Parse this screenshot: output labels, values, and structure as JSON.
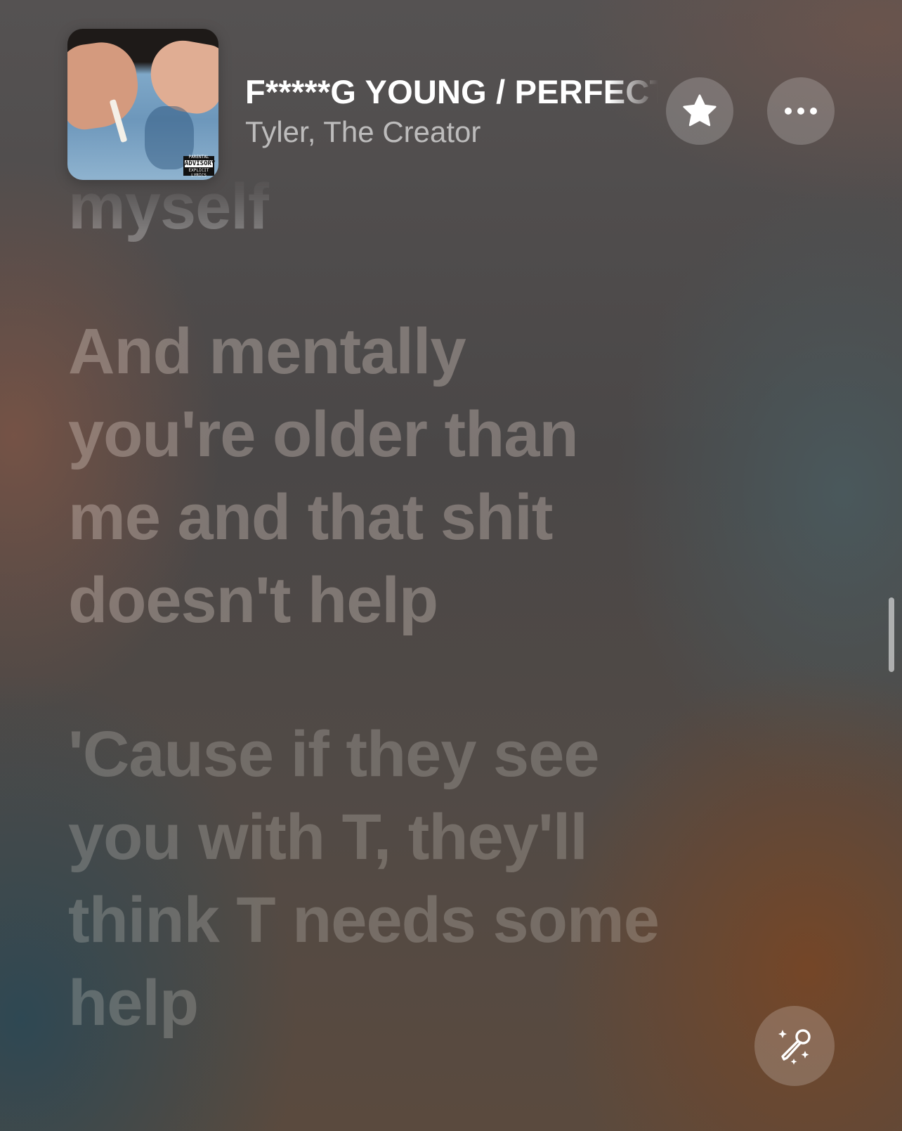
{
  "now_playing": {
    "title": "F*****G YOUNG / PERFECT",
    "artist": "Tyler, The Creator",
    "album_art_icon": "album-cover",
    "advisory_label_top": "PARENTAL",
    "advisory_label_main": "ADVISORY",
    "advisory_label_bottom": "EXPLICIT LYRICS"
  },
  "actions": {
    "favorite_icon": "star-icon",
    "more_icon": "ellipsis-icon",
    "sing_icon": "microphone-sparkles-icon"
  },
  "lyrics": {
    "previous_fragment": "myself",
    "lines": [
      "And mentally\nyou're older than\nme and that shit\ndoesn't help",
      "'Cause if they see\nyou with T, they'll\nthink T needs some\nhelp"
    ]
  },
  "colors": {
    "lyric_inactive": "#ffffff",
    "button_fill": "rgba(255,255,255,0.2)"
  }
}
